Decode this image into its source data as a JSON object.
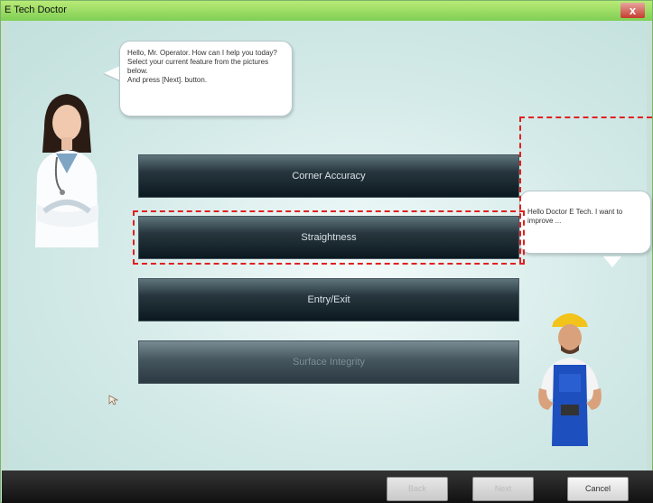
{
  "window": {
    "title": "E Tech Doctor",
    "close_label": "x"
  },
  "doctor_bubble": {
    "lines": [
      "Hello, Mr. Operator. How can I help you today?",
      "Select your current feature from the pictures below.",
      "And press [Next]. button."
    ]
  },
  "worker_bubble": {
    "text": "Hello Doctor E Tech. I want to improve ..."
  },
  "menu": {
    "items": [
      {
        "label": "Corner Accuracy",
        "enabled": true
      },
      {
        "label": "Straightness",
        "enabled": true,
        "highlighted": true
      },
      {
        "label": "Entry/Exit",
        "enabled": true
      },
      {
        "label": "Surface Integrity",
        "enabled": false
      }
    ]
  },
  "footer": {
    "back_label": "Back",
    "next_label": "Next",
    "cancel_label": "Cancel"
  },
  "colors": {
    "title_bar": "#7fcf55",
    "highlight_dash": "#e02020",
    "menu_button": "#1c2a32"
  },
  "icons": {
    "close": "close-icon",
    "doctor": "doctor-avatar",
    "worker": "worker-avatar",
    "cursor": "pointer-icon"
  }
}
